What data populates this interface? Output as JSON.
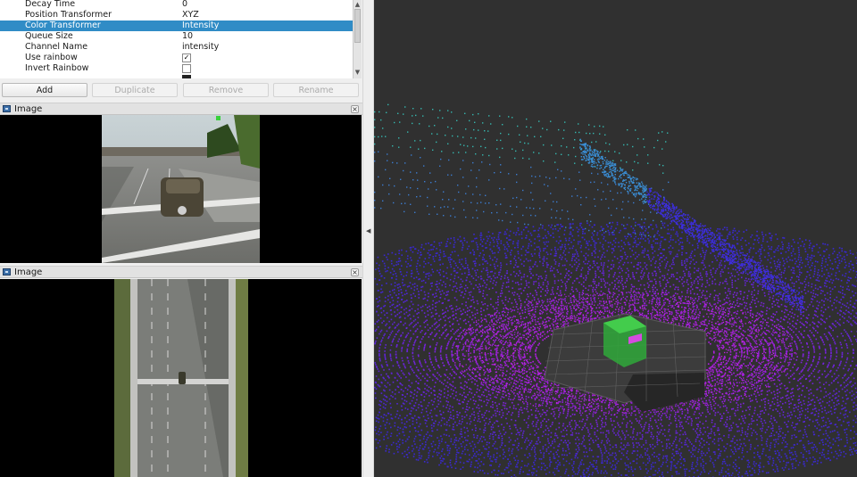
{
  "properties": {
    "rows": [
      {
        "key": "Decay Time",
        "value": "0"
      },
      {
        "key": "Position Transformer",
        "value": "XYZ"
      },
      {
        "key": "Color Transformer",
        "value": "Intensity",
        "selected": true
      },
      {
        "key": "Queue Size",
        "value": "10"
      },
      {
        "key": "Channel Name",
        "value": "intensity"
      },
      {
        "key": "Use rainbow",
        "checked": true
      },
      {
        "key": "Invert Rainbow",
        "checked": false
      }
    ]
  },
  "buttons": {
    "add": "Add",
    "duplicate": "Duplicate",
    "remove": "Remove",
    "rename": "Rename"
  },
  "panels": {
    "image1_title": "Image",
    "image2_title": "Image",
    "close_glyph": "×"
  },
  "colors": {
    "selection": "#308cc6",
    "viewport_bg": "#303030",
    "cloud_near": "#b21ee6",
    "cloud_far": "#3b2fd4",
    "vehicle_box": "#2fc43a"
  }
}
